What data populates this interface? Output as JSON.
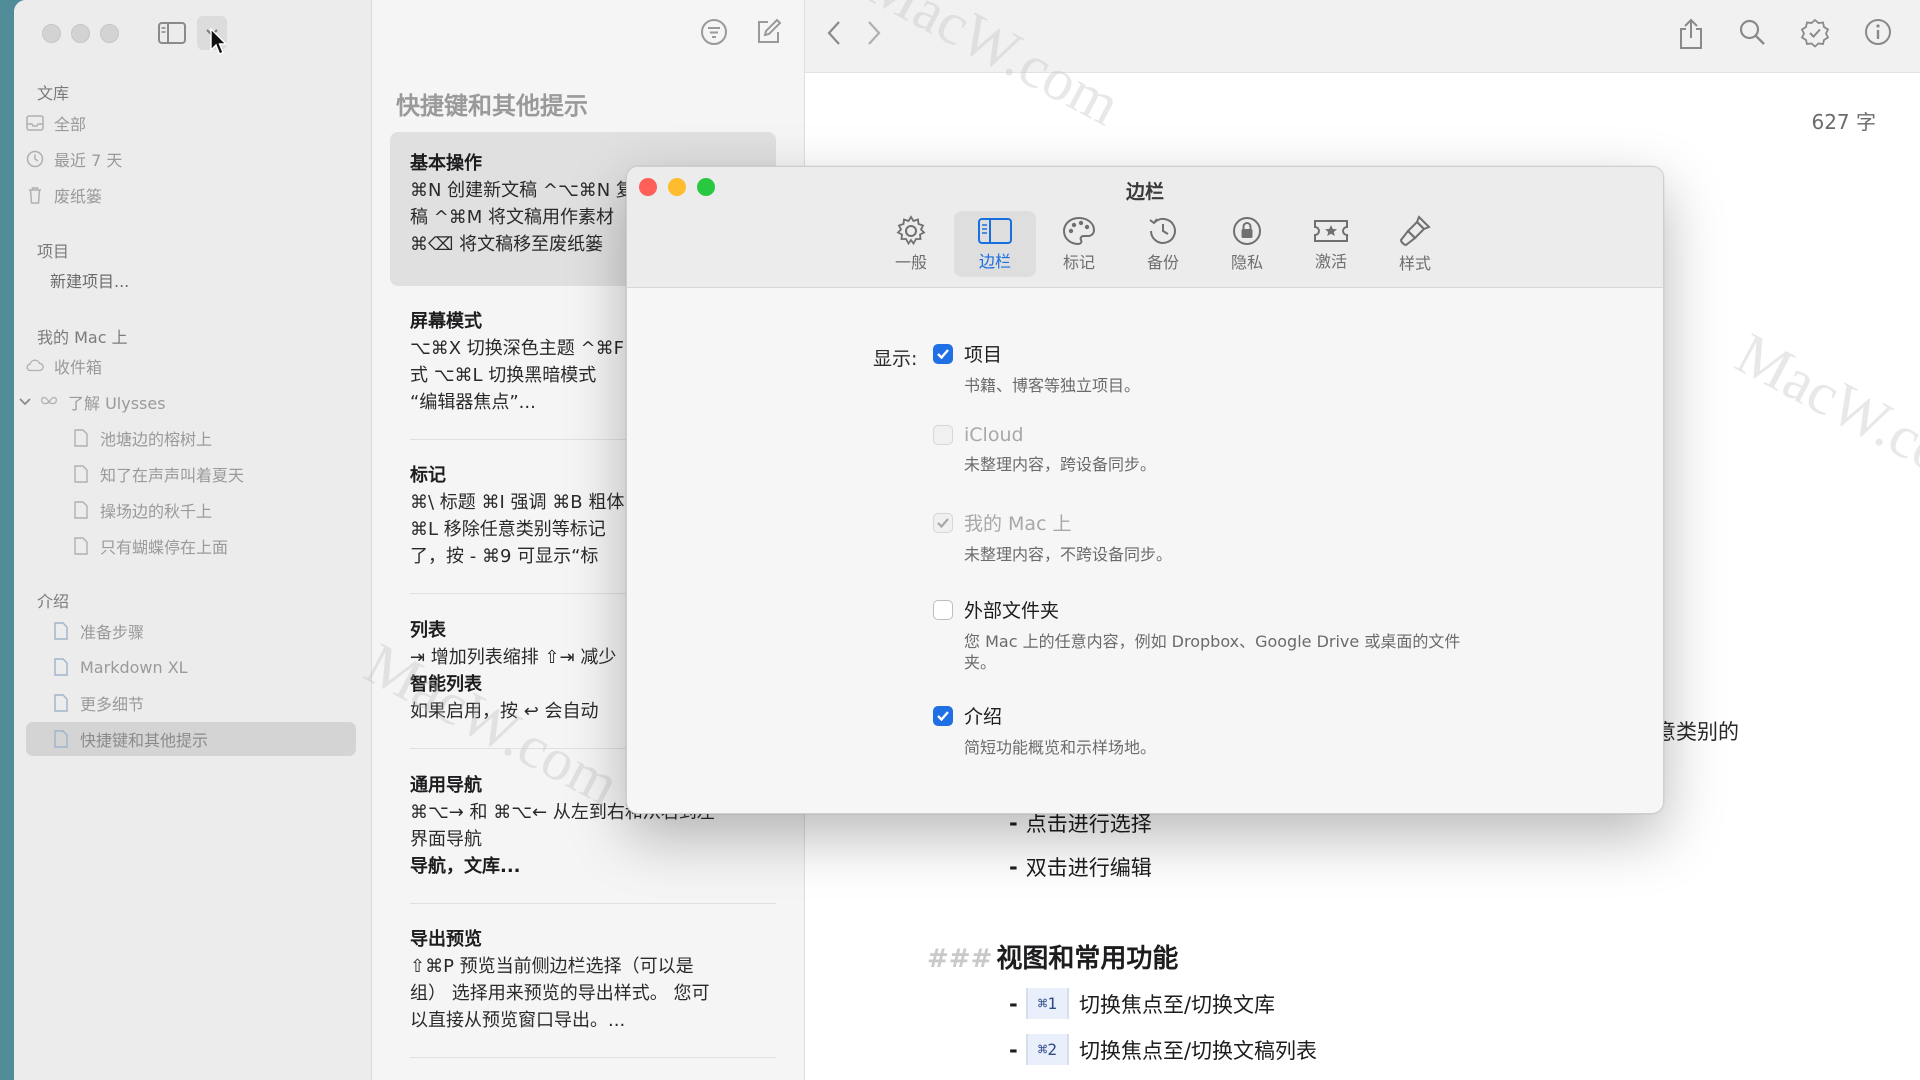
{
  "sidebar": {
    "sections": {
      "library": "文库",
      "projects": "项目",
      "on_mac": "我的 Mac 上",
      "intro": "介绍"
    },
    "library_items": [
      "全部",
      "最近 7 天",
      "废纸篓"
    ],
    "new_project": "新建项目...",
    "mac_items": {
      "inbox": "收件箱",
      "ulysses": "了解 Ulysses",
      "children": [
        "池塘边的榕树上",
        "知了在声声叫着夏天",
        "操场边的秋千上",
        "只有蝴蝶停在上面"
      ]
    },
    "intro_items": [
      "准备步骤",
      "Markdown XL",
      "更多细节",
      "快捷键和其他提示"
    ]
  },
  "sheetlist": {
    "group_title": "快捷键和其他提示",
    "sheets": [
      {
        "title": "基本操作",
        "lines": [
          "⌘N 创建新文稿 ^⌥⌘N 复制文",
          "稿 ^⌘M 将文稿用作素材",
          "⌘⌫ 将文稿移至废纸篓"
        ]
      },
      {
        "title": "屏幕模式",
        "lines": [
          "⌥⌘X 切换深色主题 ^⌘F 全屏模",
          "式 ⌥⌘L 切换黑暗模式",
          "“编辑器焦点”..."
        ]
      },
      {
        "title": "标记",
        "lines": [
          "⌘\\ 标题 ⌘I 强调 ⌘B 粗体",
          "⌘L 移除任意类别等标记",
          "了，按 - ⌘9 可显示“标"
        ]
      },
      {
        "title": "列表",
        "lines": [
          "⇥ 增加列表缩排 ⇧⇥ 减少",
          "智能列表",
          "如果启用，按 ↩ 会自动"
        ]
      },
      {
        "title": "通用导航",
        "lines": [
          "⌘⌥→ 和 ⌘⌥← 从左到右和从右到左",
          "界面导航",
          "导航，文库..."
        ]
      },
      {
        "title": "导出预览",
        "lines": [
          "⇧⌘P 预览当前侧边栏选择（可以是",
          "组） 选择用来预览的导出样式。 您可",
          "以直接从预览窗口导出。..."
        ]
      }
    ]
  },
  "editor": {
    "word_count": "627 字",
    "partial_text": "意类别的",
    "bullets": [
      "点击进行选择",
      "双击进行编辑"
    ],
    "heading_marker": "###",
    "heading": "视图和常用功能",
    "shortcut_rows": [
      {
        "key": "⌘1",
        "text": "切换焦点至/切换文库"
      },
      {
        "key": "⌘2",
        "text": "切换焦点至/切换文稿列表"
      }
    ],
    "watermark": "MacW.com"
  },
  "dialog": {
    "title": "边栏",
    "tabs": [
      {
        "label": "一般",
        "icon": "gear-icon"
      },
      {
        "label": "边栏",
        "icon": "sidebar-icon"
      },
      {
        "label": "标记",
        "icon": "palette-icon"
      },
      {
        "label": "备份",
        "icon": "clock-icon"
      },
      {
        "label": "隐私",
        "icon": "lock-icon"
      },
      {
        "label": "激活",
        "icon": "ticket-icon"
      },
      {
        "label": "样式",
        "icon": "brush-icon"
      }
    ],
    "selected_tab": "边栏",
    "show_label": "显示:",
    "options": [
      {
        "label": "项目",
        "desc": "书籍、博客等独立项目。",
        "checked": true,
        "enabled": true
      },
      {
        "label": "iCloud",
        "desc": "未整理内容，跨设备同步。",
        "checked": false,
        "enabled": false
      },
      {
        "label": "我的 Mac 上",
        "desc": "未整理内容，不跨设备同步。",
        "checked": true,
        "enabled": false
      },
      {
        "label": "外部文件夹",
        "desc": "您 Mac 上的任意内容，例如 Dropbox、Google Drive 或桌面的文件夹。",
        "checked": false,
        "enabled": true
      },
      {
        "label": "介绍",
        "desc": "简短功能概览和示样场地。",
        "checked": true,
        "enabled": true
      }
    ]
  },
  "colors": {
    "accent": "#1f6fe5",
    "close": "#fe5f57",
    "minimize": "#febc2e",
    "zoom": "#28c840"
  }
}
